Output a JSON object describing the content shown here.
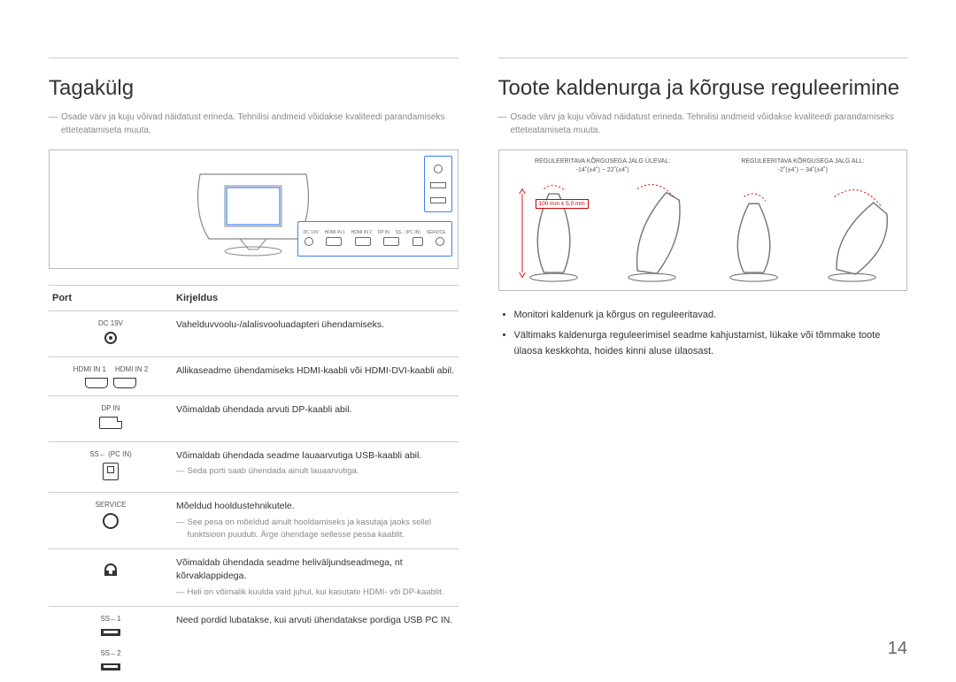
{
  "page_number": "14",
  "left": {
    "heading": "Tagakülg",
    "note": "Osade värv ja kuju võivad näidatust erineda. Tehnilisi andmeid võidakse kvaliteedi parandamiseks etteteatamiseta muuta.",
    "panel_labels": {
      "headphone": "Ω",
      "usb1": "SS←1",
      "usb2": "SS←2",
      "dc": "DC 19V",
      "hdmi1": "HDMI IN 1",
      "hdmi2": "HDMI IN 2",
      "dp": "DP IN",
      "pcin": "SS←(PC IN)",
      "service": "SERVICE"
    },
    "table": {
      "header_port": "Port",
      "header_desc": "Kirjeldus",
      "rows": [
        {
          "port_label": "DC 19V",
          "icon": "dc",
          "desc": "Vahelduvvoolu-/alalisvooluadapteri ühendamiseks."
        },
        {
          "port_label_split": [
            "HDMI IN 1",
            "HDMI IN 2"
          ],
          "icon": "hdmi-pair",
          "desc": "Allikaseadme ühendamiseks HDMI-kaabli või HDMI-DVI-kaabli abil."
        },
        {
          "port_label": "DP IN",
          "icon": "dp",
          "desc": "Võimaldab ühendada arvuti DP-kaabli abil."
        },
        {
          "port_label": "SS← (PC IN)",
          "icon": "usb-b",
          "desc": "Võimaldab ühendada seadme lauaarvutiga USB-kaabli abil.",
          "sub": "Seda porti saab ühendada ainult lauaarvutiga."
        },
        {
          "port_label": "SERVICE",
          "icon": "service",
          "desc": "Mõeldud hooldustehnikutele.",
          "sub": "See pesa on mõeldud ainult hooldamiseks ja kasutaja jaoks sellel funktsioon puudub. Ärge ühendage sellesse pessa kaablit."
        },
        {
          "port_label": "Ω",
          "icon": "headphone",
          "desc": "Võimaldab ühendada seadme heliväljundseadmega, nt kõrvaklappidega.",
          "sub": "Heli on võimalik kuulda vaid juhul, kui kasutate HDMI- või DP-kaablit."
        },
        {
          "port_label_split": [
            "SS←1",
            "SS←2"
          ],
          "icon": "usb-a-pair",
          "desc": "Need pordid lubatakse, kui arvuti ühendatakse pordiga USB PC IN."
        }
      ]
    }
  },
  "right": {
    "heading": "Toote kaldenurga ja kõrguse reguleerimine",
    "note": "Osade värv ja kuju võivad näidatust erineda. Tehnilisi andmeid võidakse kvaliteedi parandamiseks etteteatamiseta muuta.",
    "captions": {
      "left_group": "REGULEERITAVA KÕRGUSEGA JALG ÜLEVAL:\n-14˚(±4˚) ~ 22˚(±4˚)",
      "right_group": "REGULEERITAVA KÕRGUSEGA JALG ALL:\n-2˚(±4˚) ~ 34˚(±4˚)",
      "height_range": "100 mm ± 5,0 mm"
    },
    "bullets": [
      "Monitori kaldenurk ja kõrgus on reguleeritavad.",
      "Vältimaks kaldenurga reguleerimisel seadme kahjustamist, lükake või tõmmake toote ülaosa keskkohta, hoides kinni aluse ülaosast."
    ]
  }
}
